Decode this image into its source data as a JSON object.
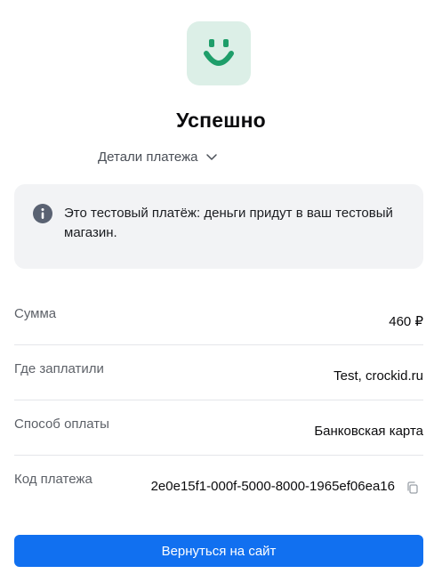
{
  "header": {
    "logo_icon": "smiley-face-icon",
    "title": "Успешно",
    "details_toggle_label": "Детали платежа",
    "details_toggle_icon": "chevron-down-icon"
  },
  "notice": {
    "icon": "info-icon",
    "text": "Это тестовый платёж: деньги придут в ваш тестовый магазин."
  },
  "details": [
    {
      "label": "Сумма",
      "value": "460 ₽"
    },
    {
      "label": "Где заплатили",
      "value": "Test, crockid.ru"
    },
    {
      "label": "Способ оплаты",
      "value": "Банковская карта"
    },
    {
      "label": "Код платежа",
      "value": "2e0e15f1-000f-5000-8000-1965ef06ea16",
      "action_icon": "copy-icon"
    }
  ],
  "actions": {
    "return_label": "Вернуться на сайт"
  },
  "colors": {
    "brand_green": "#1e9e6a",
    "logo_bg": "#dcefe7",
    "primary_button": "#1170f0",
    "notice_bg": "#f2f3f5"
  }
}
